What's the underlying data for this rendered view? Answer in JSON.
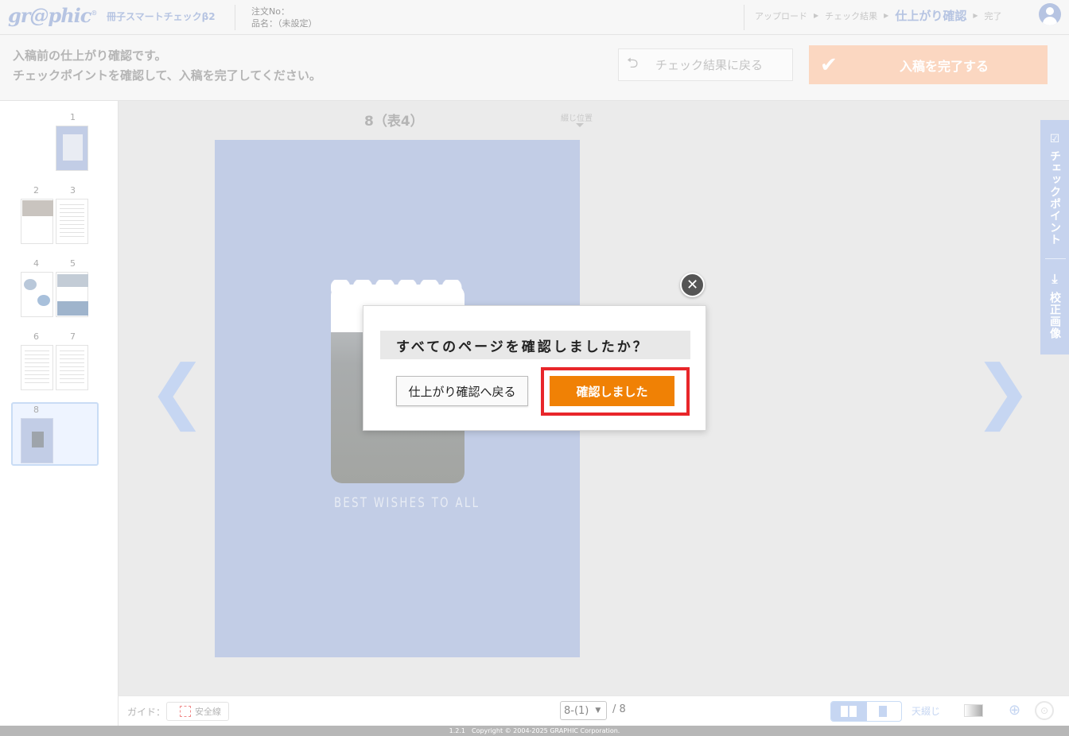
{
  "header": {
    "logo": "gr@phic",
    "app_name": "冊子スマートチェックβ2",
    "order_no": "注文No：",
    "product_name": "品名：（未設定）",
    "steps": [
      "アップロード",
      "チェック結果",
      "仕上がり確認",
      "完了"
    ],
    "current_step": "仕上がり確認"
  },
  "toolbar": {
    "instruction_line1": "入稿前の仕上がり確認です。",
    "instruction_line2": "チェックポイントを確認して、入稿を完了してください。",
    "back_label": "チェック結果に戻る",
    "complete_label": "入稿を完了する"
  },
  "thumbnails": {
    "labels": [
      "1",
      "2",
      "3",
      "4",
      "5",
      "6",
      "7",
      "8"
    ],
    "selected": "8"
  },
  "viewer": {
    "page_title": "8（表4）",
    "binding_position": "綴じ位置",
    "page_text": "BEST WISHES TO ALL"
  },
  "side_tabs": {
    "checkpoint": "チェックポイント",
    "proof_image": "校正画像"
  },
  "bottombar": {
    "guide_label": "ガイド：",
    "safety_line": "安全線",
    "page_select": "8-(1)",
    "page_total": "/ 8",
    "binding": "天綴じ"
  },
  "footer": {
    "copyright": "1.2.1　Copyright © 2004-2025 GRAPHIC Corporation."
  },
  "modal": {
    "question": "すべてのページを確認しましたか？",
    "back_button": "仕上がり確認へ戻る",
    "confirm_button": "確認しました"
  }
}
